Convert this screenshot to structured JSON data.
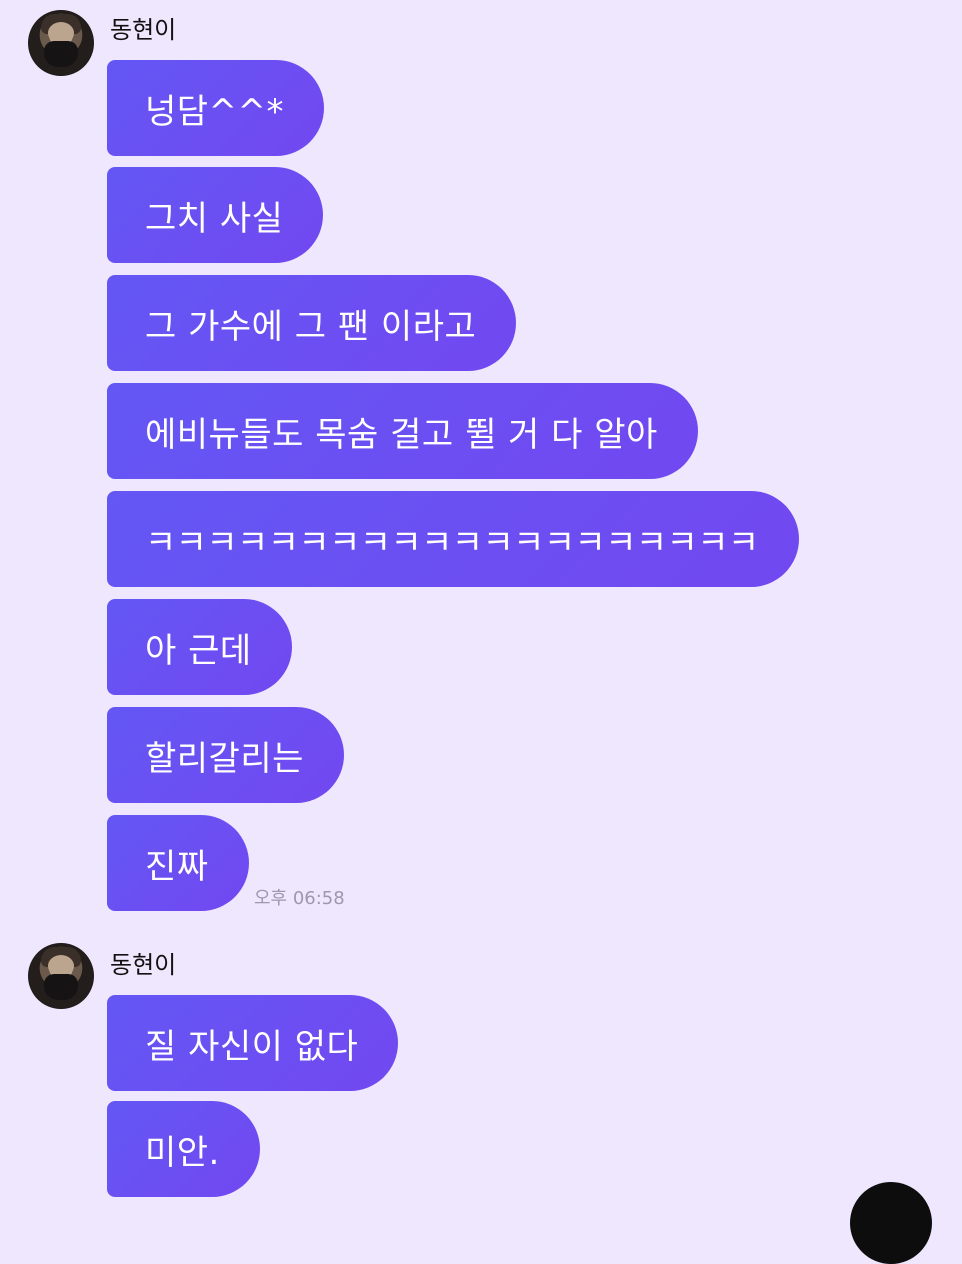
{
  "chat": {
    "sender_name": "동현이",
    "messages": [
      "넝담^^*",
      "그치 사실",
      "그 가수에 그 팬 이라고",
      "에비뉴들도 목숨 걸고 뛸 거 다 알아",
      "ㅋㅋㅋㅋㅋㅋㅋㅋㅋㅋㅋㅋㅋㅋㅋㅋㅋㅋㅋㅋ",
      "아 근데",
      "할리갈리는",
      "진짜",
      "질 자신이 없다",
      "미안."
    ],
    "timestamp": "오후 06:58"
  },
  "colors": {
    "background": "#efe7fd",
    "bubble_start": "#6357f4",
    "bubble_end": "#7248f0",
    "text": "#ffffff",
    "timestamp": "#9f98ad"
  }
}
